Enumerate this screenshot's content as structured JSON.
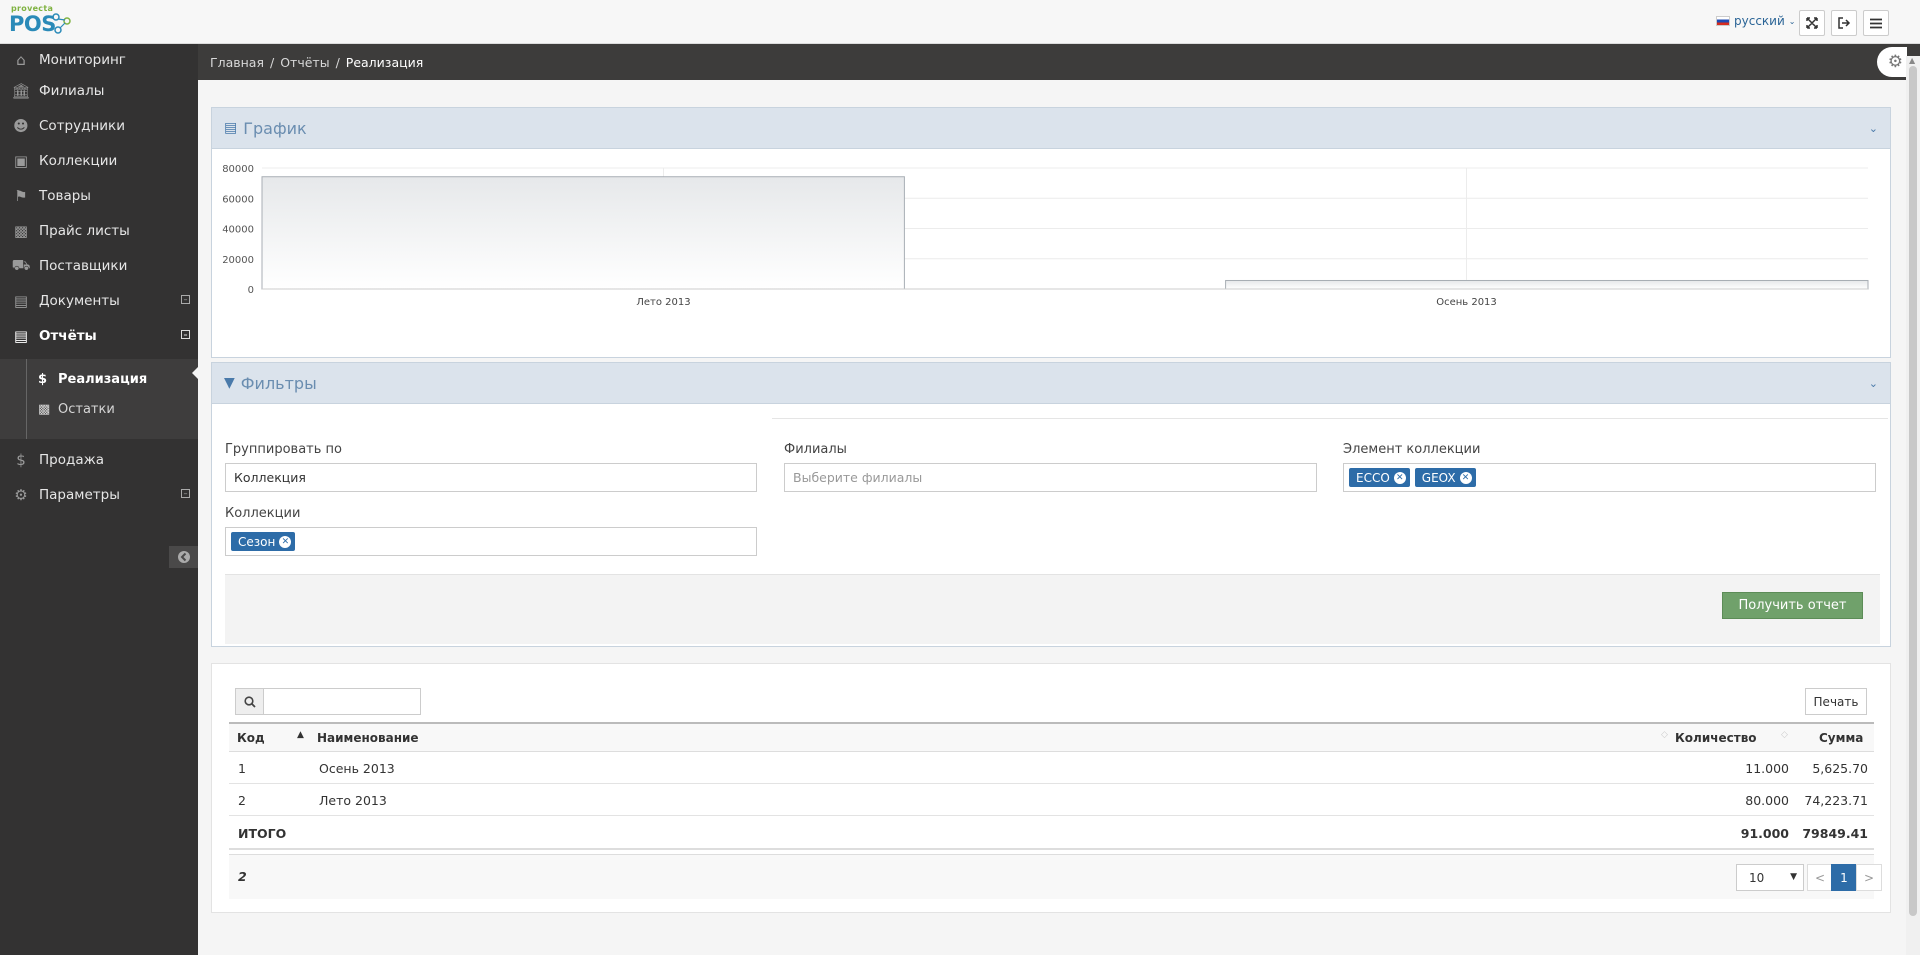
{
  "app": {
    "logo_small": "provecta",
    "logo_big": "POS",
    "language": "русский"
  },
  "sidebar": {
    "items": [
      {
        "label": "Мониторинг",
        "icon": "home-icon"
      },
      {
        "label": "Филиалы",
        "icon": "bank-icon"
      },
      {
        "label": "Сотрудники",
        "icon": "users-icon"
      },
      {
        "label": "Коллекции",
        "icon": "archive-icon"
      },
      {
        "label": "Товары",
        "icon": "tags-icon"
      },
      {
        "label": "Прайс листы",
        "icon": "money-icon"
      },
      {
        "label": "Поставщики",
        "icon": "car-icon"
      },
      {
        "label": "Документы",
        "icon": "suitcase-icon"
      },
      {
        "label": "Отчёты",
        "icon": "bar-chart-icon"
      },
      {
        "label": "Продажа",
        "icon": "dollar-icon"
      },
      {
        "label": "Параметры",
        "icon": "cogs-icon"
      }
    ],
    "subitems": [
      {
        "label": "Реализация",
        "icon": "dollar-icon"
      },
      {
        "label": "Остатки",
        "icon": "money-icon"
      }
    ]
  },
  "breadcrumb": {
    "items": [
      "Главная",
      "Отчёты",
      "Реализация"
    ]
  },
  "graph_panel": {
    "title": "График"
  },
  "chart_data": {
    "type": "area",
    "title": "",
    "xlabel": "",
    "ylabel": "",
    "categories": [
      "Лето 2013",
      "Осень 2013"
    ],
    "values": [
      74223.71,
      5625.7
    ],
    "yticks": [
      "80000",
      "60000",
      "40000",
      "20000",
      "0"
    ],
    "ylim": [
      0,
      80000
    ],
    "grid": true,
    "fill_color": "#e6e8ea",
    "line_color": "#a8aeb4"
  },
  "filters_panel": {
    "title": "Фильтры",
    "group_by_label": "Группировать по",
    "group_by_value": "Коллекция",
    "branches_label": "Филиалы",
    "branches_placeholder": "Выберите филиалы",
    "element_label": "Элемент коллекции",
    "element_tags": [
      "ECCO",
      "GEOX"
    ],
    "collections_label": "Коллекции",
    "collections_tags": [
      "Сезон"
    ],
    "submit_label": "Получить отчет"
  },
  "table": {
    "print_label": "Печать",
    "columns": [
      "Код",
      "Наименование",
      "Количество",
      "Сумма"
    ],
    "rows": [
      {
        "code": "1",
        "name": "Осень 2013",
        "qty": "11.000",
        "sum": "5,625.70"
      },
      {
        "code": "2",
        "name": "Лето 2013",
        "qty": "80.000",
        "sum": "74,223.71"
      }
    ],
    "total": {
      "label": "ИТОГО",
      "qty": "91.000",
      "sum": "79849.41"
    },
    "count": "2",
    "page_size": "10",
    "prev": "<",
    "page": "1",
    "next": ">"
  },
  "colors": {
    "sidebar_bg": "#333232",
    "accent": "#2d6ca8",
    "success": "#70a16b"
  }
}
